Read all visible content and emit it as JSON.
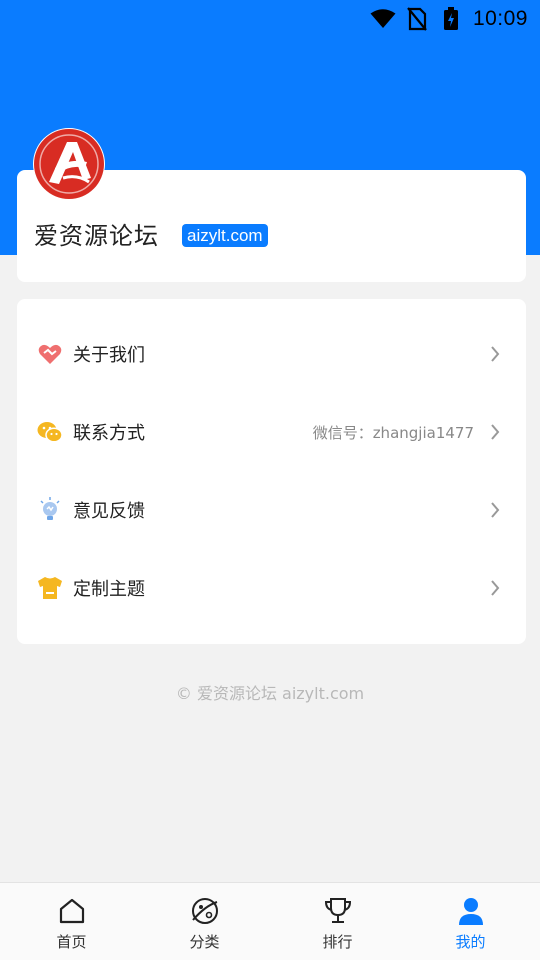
{
  "status_bar": {
    "time": "10:09",
    "icons": [
      "wifi-icon",
      "no-sim-icon",
      "battery-charging-icon"
    ]
  },
  "profile": {
    "avatar_icon": "aizylt-logo",
    "name": "爱资源论坛",
    "badge": "aizylt.com"
  },
  "menu": {
    "items": [
      {
        "label": "关于我们",
        "icon": "heart-handshake-icon",
        "value": ""
      },
      {
        "label": "联系方式",
        "icon": "wechat-icon",
        "value": "微信号：zhangjia1477"
      },
      {
        "label": "意见反馈",
        "icon": "lightbulb-icon",
        "value": ""
      },
      {
        "label": "定制主题",
        "icon": "tshirt-icon",
        "value": ""
      }
    ]
  },
  "copyright": "© 爱资源论坛 aizylt.com",
  "bottom_nav": {
    "items": [
      {
        "label": "首页",
        "icon": "home-icon"
      },
      {
        "label": "分类",
        "icon": "planet-icon"
      },
      {
        "label": "排行",
        "icon": "trophy-icon"
      },
      {
        "label": "我的",
        "icon": "user-icon",
        "active": true
      }
    ]
  },
  "colors": {
    "primary": "#0a7cff",
    "background": "#f2f2f2",
    "card": "#ffffff"
  }
}
